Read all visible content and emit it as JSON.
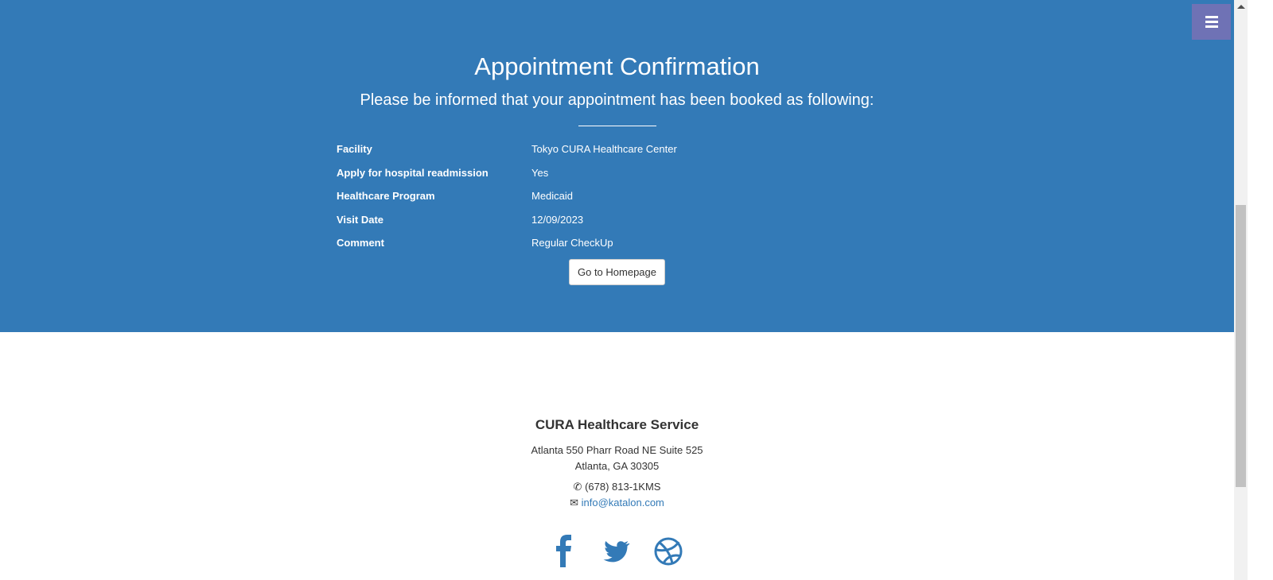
{
  "header": {
    "title": "Appointment Confirmation",
    "subtitle": "Please be informed that your appointment has been booked as following:"
  },
  "details": [
    {
      "label": "Facility",
      "value": "Tokyo CURA Healthcare Center"
    },
    {
      "label": "Apply for hospital readmission",
      "value": "Yes"
    },
    {
      "label": "Healthcare Program",
      "value": "Medicaid"
    },
    {
      "label": "Visit Date",
      "value": "12/09/2023"
    },
    {
      "label": "Comment",
      "value": "Regular CheckUp"
    }
  ],
  "button": {
    "label": "Go to Homepage"
  },
  "footer": {
    "title": "CURA Healthcare Service",
    "address1": "Atlanta 550 Pharr Road NE Suite 525",
    "address2": "Atlanta, GA 30305",
    "phone": "(678) 813-1KMS",
    "email": "info@katalon.com"
  },
  "colors": {
    "primary": "#337ab7",
    "menu": "#6f72b5"
  }
}
